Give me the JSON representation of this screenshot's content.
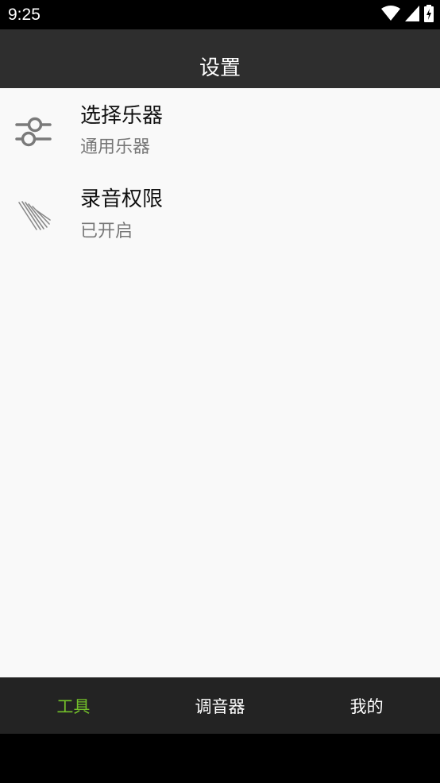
{
  "status_bar": {
    "time": "9:25",
    "icons": [
      "wifi-icon",
      "cell-signal-icon",
      "battery-charging-icon"
    ]
  },
  "app_bar": {
    "title": "设置"
  },
  "settings": {
    "items": [
      {
        "title": "选择乐器",
        "subtitle": "通用乐器",
        "icon": "sliders-icon"
      },
      {
        "title": "录音权限",
        "subtitle": "已开启",
        "icon": "microphone-lines-icon"
      }
    ]
  },
  "bottom_nav": {
    "tabs": [
      {
        "label": "工具",
        "active": true
      },
      {
        "label": "调音器",
        "active": false
      },
      {
        "label": "我的",
        "active": false
      }
    ],
    "active_color": "#73c02a",
    "inactive_color": "#ffffff"
  },
  "colors": {
    "status_bar": "#000000",
    "app_bar": "#2e2e2e",
    "content_bg": "#f9f9f9",
    "nav_bg": "#232323"
  }
}
